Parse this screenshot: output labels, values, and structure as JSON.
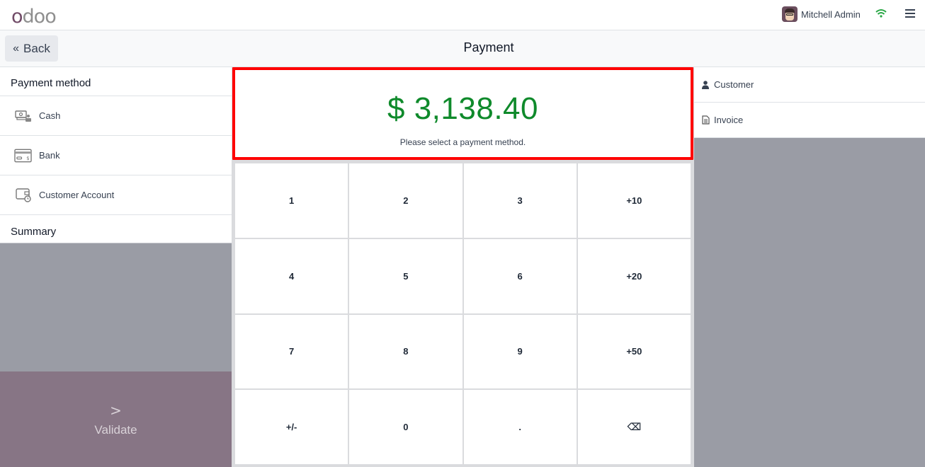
{
  "navbar": {
    "logo": {
      "first": "o",
      "rest": "doo"
    },
    "user_name": "Mitchell Admin",
    "icons": [
      "avatar",
      "wifi-icon",
      "hamburger-menu-icon"
    ],
    "wifi_color": "#28a745"
  },
  "controlbar": {
    "back_label": "Back",
    "title": "Payment"
  },
  "left_panel": {
    "payment_method_title": "Payment method",
    "methods": [
      {
        "label": "Cash",
        "icon": "cash-icon"
      },
      {
        "label": "Bank",
        "icon": "bank-card-icon"
      },
      {
        "label": "Customer Account",
        "icon": "customer-account-icon"
      }
    ],
    "summary_title": "Summary",
    "validate_label": "Validate"
  },
  "center": {
    "amount": "$ 3,138.40",
    "amount_color": "#0f8a2b",
    "message": "Please select a payment method.",
    "keypad": [
      "1",
      "2",
      "3",
      "+10",
      "4",
      "5",
      "6",
      "+20",
      "7",
      "8",
      "9",
      "+50",
      "+/-",
      "0",
      ".",
      "⌫"
    ]
  },
  "right_panel": {
    "items": [
      {
        "label": "Customer",
        "icon": "user-icon"
      },
      {
        "label": "Invoice",
        "icon": "file-icon"
      }
    ]
  },
  "colors": {
    "brand": "#714b67",
    "validate_bg": "#877585",
    "highlight_border": "#ff0000"
  }
}
